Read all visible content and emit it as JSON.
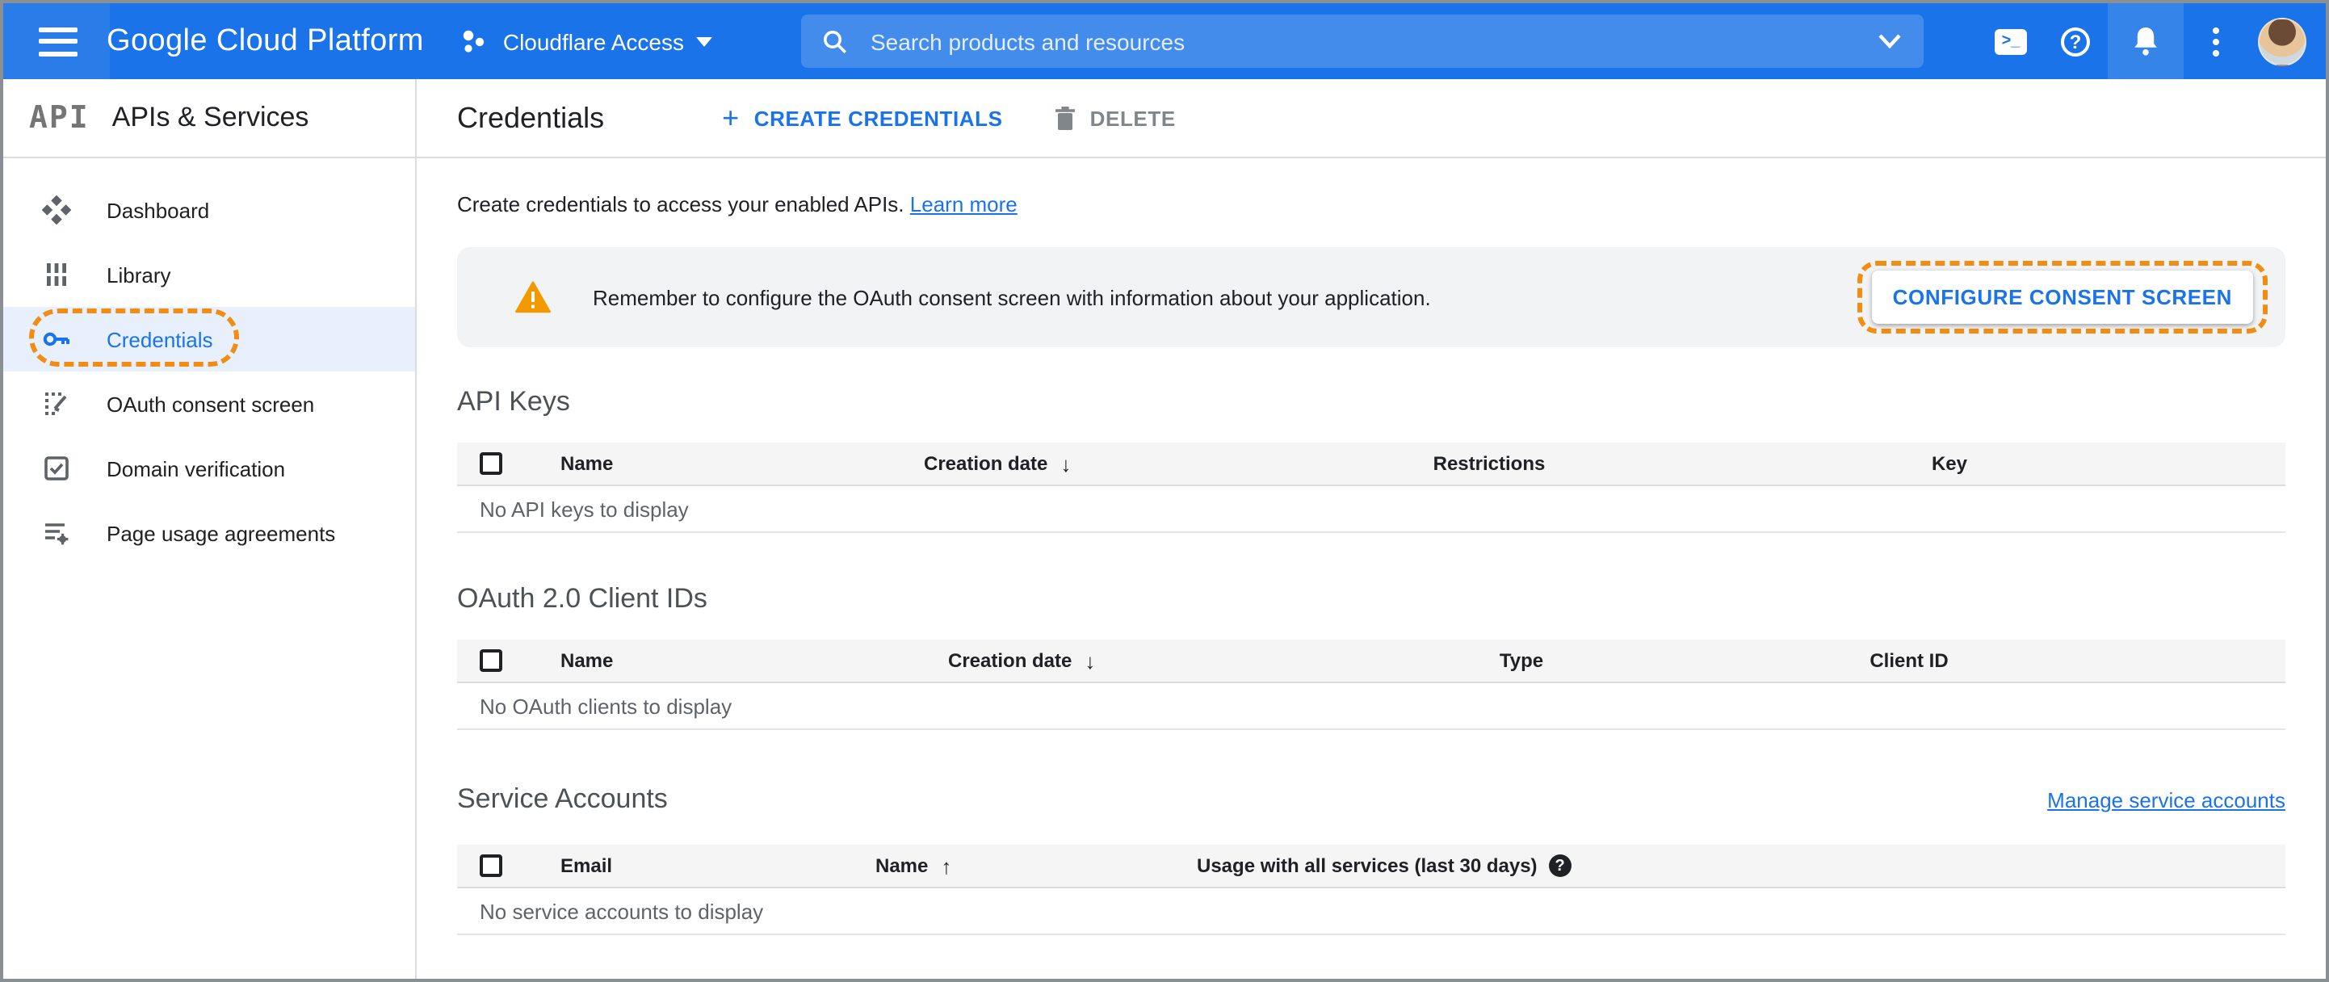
{
  "header": {
    "product_name": "Google Cloud Platform",
    "project_selector": {
      "label": "Cloudflare Access"
    },
    "search": {
      "placeholder": "Search products and resources"
    },
    "terminal_glyph": ">_",
    "help_glyph": "?"
  },
  "sidebar": {
    "logo_text": "API",
    "title": "APIs & Services",
    "items": [
      {
        "label": "Dashboard"
      },
      {
        "label": "Library"
      },
      {
        "label": "Credentials",
        "active": true
      },
      {
        "label": "OAuth consent screen"
      },
      {
        "label": "Domain verification"
      },
      {
        "label": "Page usage agreements"
      }
    ]
  },
  "toolbar": {
    "title": "Credentials",
    "create_label": "CREATE CREDENTIALS",
    "create_plus": "+",
    "delete_label": "DELETE"
  },
  "intro": {
    "text": "Create credentials to access your enabled APIs.",
    "link_label": "Learn more"
  },
  "banner": {
    "message": "Remember to configure the OAuth consent screen with information about your application.",
    "button_label": "CONFIGURE CONSENT SCREEN"
  },
  "sections": {
    "api_keys": {
      "title": "API Keys",
      "columns": [
        "Name",
        "Creation date",
        "Restrictions",
        "Key"
      ],
      "sort_arrow": "↓",
      "empty_text": "No API keys to display"
    },
    "oauth_clients": {
      "title": "OAuth 2.0 Client IDs",
      "columns": [
        "Name",
        "Creation date",
        "Type",
        "Client ID"
      ],
      "sort_arrow": "↓",
      "empty_text": "No OAuth clients to display"
    },
    "service_accounts": {
      "title": "Service Accounts",
      "manage_link_label": "Manage service accounts",
      "columns": [
        "Email",
        "Name",
        "Usage with all services (last 30 days)"
      ],
      "sort_arrow": "↑",
      "help_glyph": "?",
      "empty_text": "No service accounts to display"
    }
  },
  "colors": {
    "appbar_blue": "#1a73e8",
    "link_blue": "#1a73e8",
    "active_item_bg": "#e8f0fe",
    "highlight_orange": "#f18d12",
    "warning_orange": "#f29900",
    "banner_bg": "#f1f3f4",
    "table_header_bg": "#f5f5f5"
  }
}
